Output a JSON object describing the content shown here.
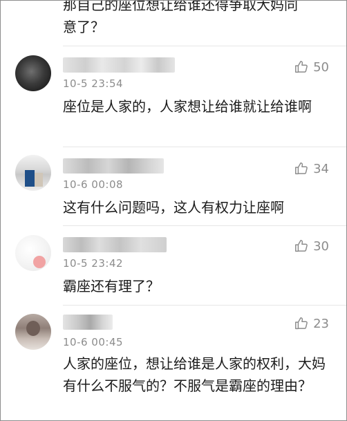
{
  "top_fragment": {
    "line1": "那自己的座位想让给谁还得争取大妈同",
    "line2": "意了？"
  },
  "icons": {
    "like": "thumbs-up-icon"
  },
  "colors": {
    "meta_text": "#8c8c8c",
    "body_text": "#1b1b1b",
    "divider": "#e6e6e6"
  },
  "comments": [
    {
      "time": "10-5 23:54",
      "likes": "50",
      "text": "座位是人家的，人家想让给谁就让给谁啊"
    },
    {
      "time": "10-6 00:08",
      "likes": "34",
      "text": "这有什么问题吗，这人有权力让座啊"
    },
    {
      "time": "10-5 23:42",
      "likes": "30",
      "text": "霸座还有理了？"
    },
    {
      "time": "10-6 00:45",
      "likes": "23",
      "text": "人家的座位，想让给谁是人家的权利，大妈有什么不服气的？不服气是霸座的理由？"
    }
  ]
}
